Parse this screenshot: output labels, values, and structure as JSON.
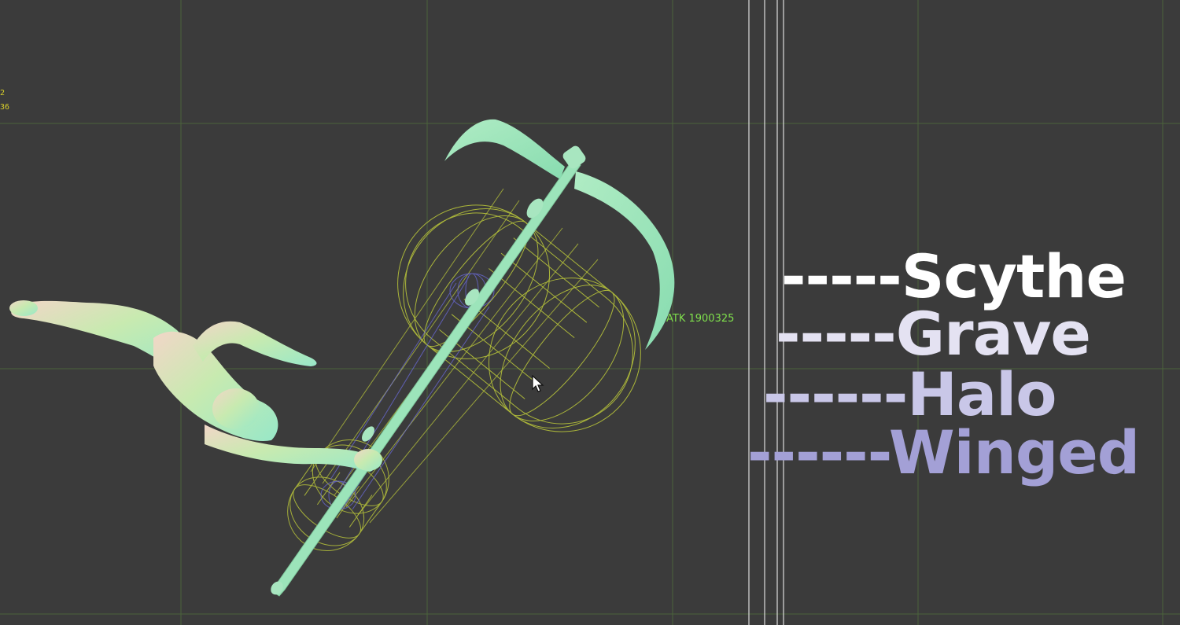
{
  "hud": {
    "line1": "2",
    "line2": "36"
  },
  "hitbox": {
    "label": "ATK 1900325"
  },
  "labels": {
    "scythe": "-----Scythe",
    "grave": "-----Grave",
    "halo": "------Halo",
    "winged": "------Winged"
  },
  "colors": {
    "background": "#3b3b3b",
    "grid": "#4e6a3c",
    "hitbox_wire": "#b8c43a",
    "inner_wire": "#6a6ad8",
    "model": "#a8e6b4",
    "hud_text": "#d8cf2a",
    "hitbox_text": "#7fe04c",
    "label_scythe": "#ffffff",
    "label_grave": "#e4e2f2",
    "label_halo": "#c9c7e8",
    "label_winged": "#a3a0d6"
  },
  "icons": {
    "cursor": "mouse-pointer-icon"
  }
}
